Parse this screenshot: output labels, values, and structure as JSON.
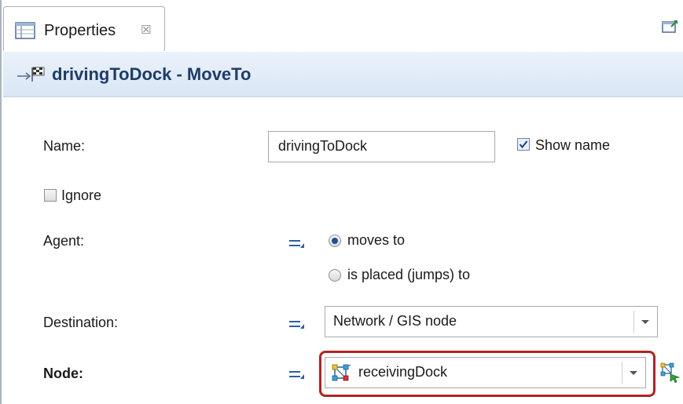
{
  "tab": {
    "label": "Properties",
    "close_glyph": "☒"
  },
  "title": "drivingToDock - MoveTo",
  "fields": {
    "name_label": "Name:",
    "name_value": "drivingToDock",
    "show_name_label": "Show name",
    "show_name_checked": true,
    "ignore_label": "Ignore",
    "ignore_checked": false,
    "agent_label": "Agent:",
    "agent_options": [
      "moves to",
      "is placed (jumps) to"
    ],
    "agent_selected": "moves to",
    "destination_label": "Destination:",
    "destination_value": "Network / GIS node",
    "node_label": "Node:",
    "node_value": "receivingDock"
  },
  "icons": {
    "tab": "properties-panel-icon",
    "maximize": "maximize-view-icon",
    "title": "moveto-flag-icon",
    "static_value": "static-value-equals-icon",
    "node": "network-node-icon",
    "select_node": "select-node-tool-icon"
  },
  "colors": {
    "title_text": "#1f3c68",
    "highlight_border": "#b22222",
    "accent_blue": "#2e5fa0"
  }
}
